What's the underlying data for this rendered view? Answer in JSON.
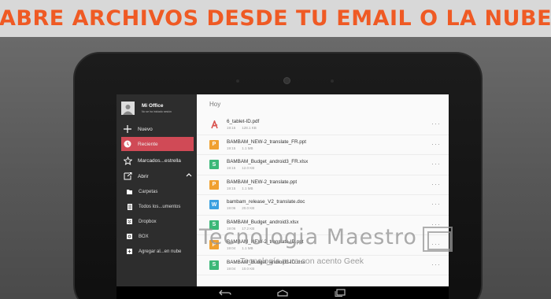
{
  "banner": {
    "title": "ABRE ARCHIVOS DESDE TU EMAIL O LA NUBE",
    "color": "#ef5a24"
  },
  "sidebar": {
    "profile": {
      "name": "Mi Office",
      "subtitle": "No se ha iniciado sesión"
    },
    "items": [
      {
        "label": "Nuevo",
        "icon": "plus-icon"
      },
      {
        "label": "Reciente",
        "icon": "clock-icon",
        "active": true
      },
      {
        "label": "Marcados...estrella",
        "icon": "star-icon"
      },
      {
        "label": "Abrir",
        "icon": "open-folder-icon"
      }
    ],
    "open_sources": [
      {
        "label": "Carpetas",
        "icon": "folder-icon"
      },
      {
        "label": "Todos los...umentos",
        "icon": "documents-icon"
      },
      {
        "label": "Dropbox",
        "icon": "dropbox-icon"
      },
      {
        "label": "BOX",
        "icon": "box-icon"
      },
      {
        "label": "Agregar al...en nube",
        "icon": "add-cloud-icon"
      }
    ],
    "active_color": "#d04a56"
  },
  "content": {
    "section": "Hoy",
    "files": [
      {
        "name": "6_tablet-ID.pdf",
        "time": "19:15",
        "size": "128.1 KB",
        "type": "pdf",
        "color": "#d9534f"
      },
      {
        "name": "BAMBAM_NEW-2_translate_FR.ppt",
        "time": "19:15",
        "size": "1.1 MB",
        "type": "ppt",
        "color": "#f0a030"
      },
      {
        "name": "BAMBAM_Budget_android3_FR.xlsx",
        "time": "19:15",
        "size": "12.0 KB",
        "type": "xlsx",
        "color": "#3cb878"
      },
      {
        "name": "BAMBAM_NEW-2_translate.ppt",
        "time": "19:15",
        "size": "1.1 MB",
        "type": "ppt",
        "color": "#f0a030"
      },
      {
        "name": "bambam_release_V2_translate.doc",
        "time": "19:06",
        "size": "20.0 KB",
        "type": "doc",
        "color": "#3aa0e0"
      },
      {
        "name": "BAMBAM_Budget_android3.xlsx",
        "time": "19:06",
        "size": "17.2 KB",
        "type": "xlsx",
        "color": "#3cb878"
      },
      {
        "name": "BAMBAM_NEW-2_translate-ID.ppt",
        "time": "19:04",
        "size": "1.1 MB",
        "type": "ppt",
        "color": "#f0a030"
      },
      {
        "name": "BAMBAM_Budget_android3-ID.xlsx",
        "time": "19:04",
        "size": "10.0 KB",
        "type": "xlsx",
        "color": "#3cb878"
      }
    ]
  },
  "watermark": {
    "title": "Tecnologia Maestro",
    "subtitle": "Tecnología pura con acento Geek"
  }
}
